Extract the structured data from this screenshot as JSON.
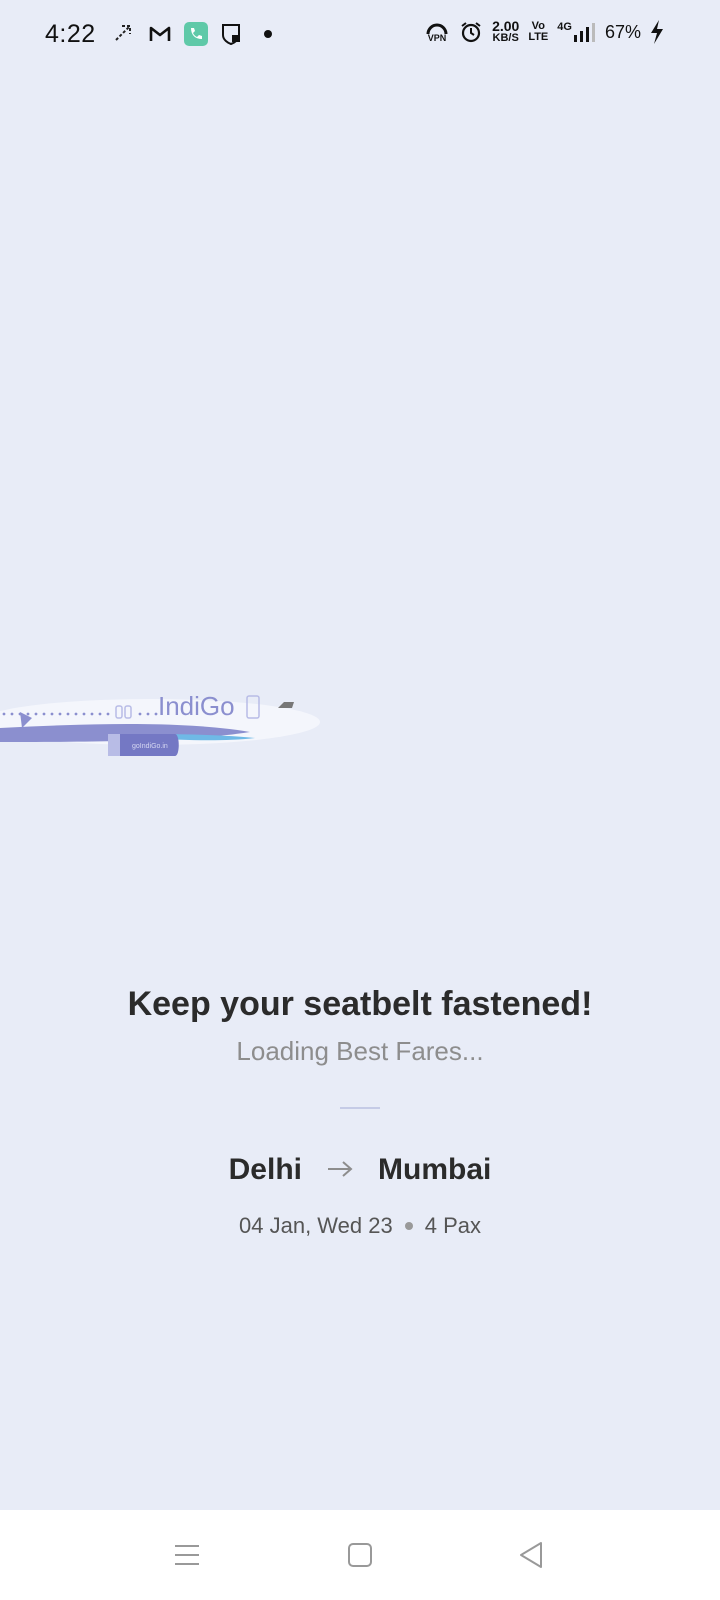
{
  "status_bar": {
    "time": "4:22",
    "net_speed_value": "2.00",
    "net_speed_unit": "KB/S",
    "volte_top": "Vo",
    "volte_bottom": "LTE",
    "network_label": "4G",
    "vpn_label": "VPN",
    "battery": "67%",
    "left_icons": [
      "missed-call-icon",
      "gmail-icon",
      "phone-app-icon",
      "shield-icon",
      "notification-dot-icon"
    ]
  },
  "plane": {
    "brand": "IndiGo",
    "engine_text": "goIndiGo.in"
  },
  "loading": {
    "headline": "Keep your seatbelt fastened!",
    "subline": "Loading Best Fares..."
  },
  "trip": {
    "from": "Delhi",
    "to": "Mumbai",
    "date": "04 Jan, Wed 23",
    "pax": "4 Pax"
  },
  "colors": {
    "background": "#e8ecf7",
    "plane_primary": "#8b8fcf",
    "plane_accent": "#6fb9e6"
  }
}
